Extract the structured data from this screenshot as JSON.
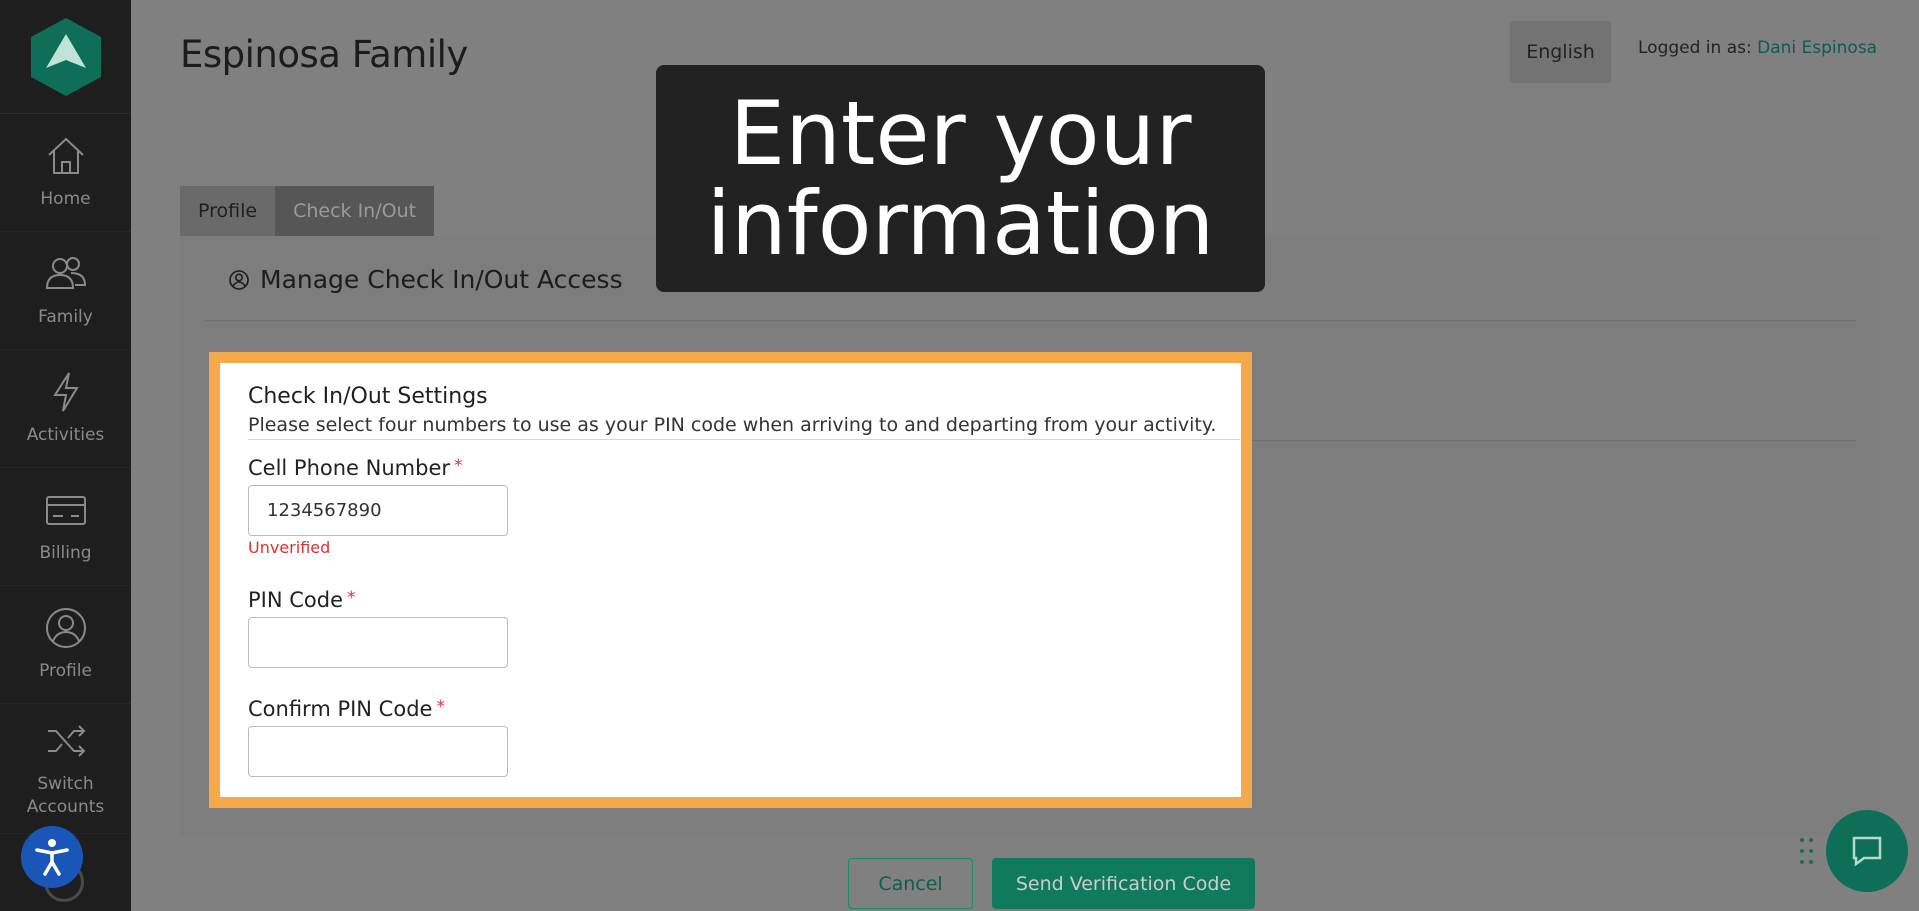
{
  "header": {
    "title": "Espinosa Family",
    "language": "English",
    "logged_in_label": "Logged in as:",
    "user_name": "Dani Espinosa"
  },
  "sidebar": {
    "items": [
      {
        "label": "Home",
        "icon": "home-icon"
      },
      {
        "label": "Family",
        "icon": "family-icon"
      },
      {
        "label": "Activities",
        "icon": "lightning-icon"
      },
      {
        "label": "Billing",
        "icon": "credit-card-icon"
      },
      {
        "label": "Profile",
        "icon": "user-circle-icon"
      },
      {
        "label": "Switch Accounts",
        "icon": "shuffle-icon"
      }
    ]
  },
  "tabs": [
    {
      "label": "Profile",
      "active": false
    },
    {
      "label": "Check In/Out",
      "active": true
    }
  ],
  "section": {
    "title": "Manage Check In/Out Access"
  },
  "banner": {
    "line1": "Enter your",
    "line2": "information"
  },
  "card": {
    "title": "Check In/Out Settings",
    "description": "Please select four numbers to use as your PIN code when arriving to and departing from your activity.",
    "phone": {
      "label": "Cell Phone Number",
      "required_mark": "*",
      "value": "1234567890",
      "status": "Unverified"
    },
    "pin": {
      "label": "PIN Code",
      "required_mark": "*",
      "value": ""
    },
    "confirm_pin": {
      "label": "Confirm PIN Code",
      "required_mark": "*",
      "value": ""
    }
  },
  "actions": {
    "cancel": "Cancel",
    "send": "Send Verification Code"
  },
  "colors": {
    "highlight": "#f5a94a",
    "accent": "#0f7a5e",
    "error": "#e03131",
    "sidebar": "#1e1e1e"
  }
}
